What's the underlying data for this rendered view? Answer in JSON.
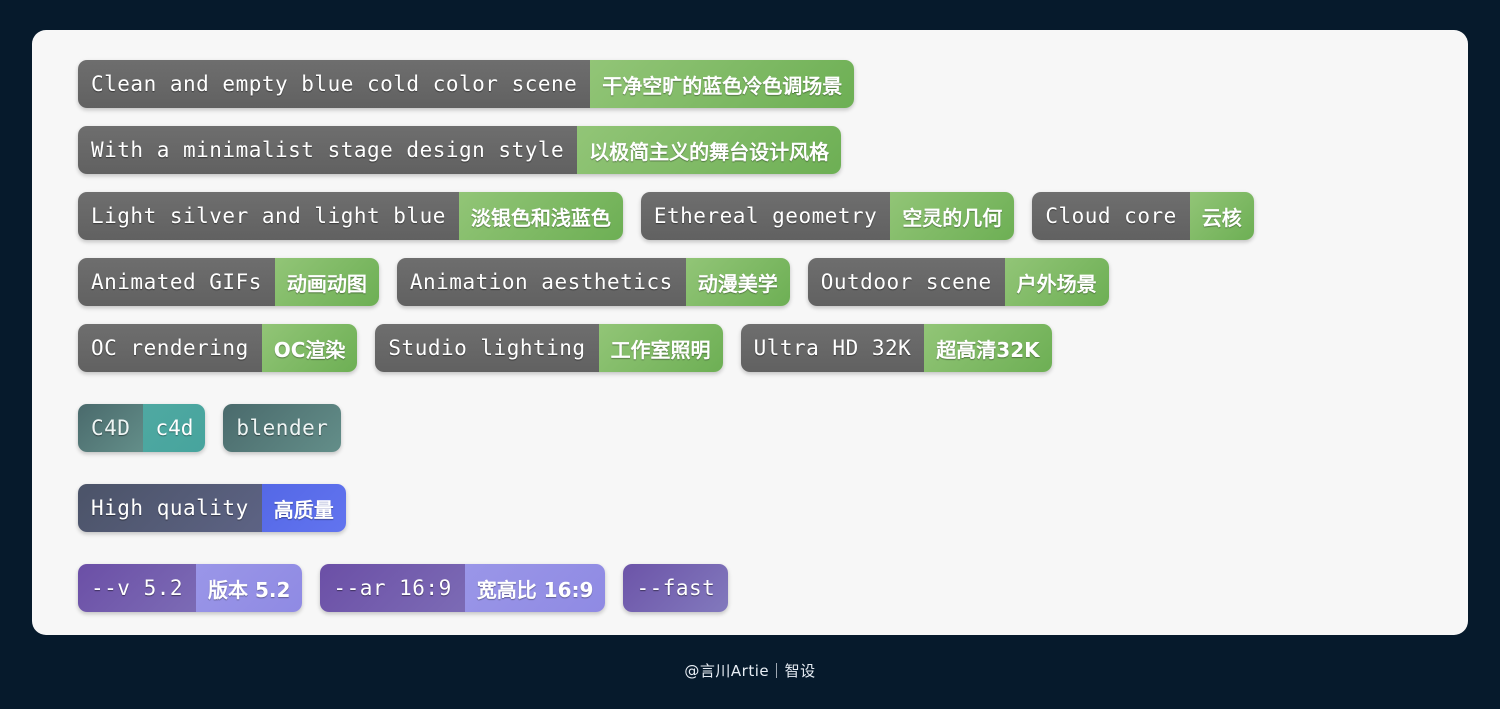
{
  "background_color": "#061a2c",
  "card_color": "#f7f7f7",
  "accent_colors": {
    "gray": "#666666",
    "green": "#6daf54",
    "teal": "#4fa9a2",
    "indigo": "#5468e6",
    "purple": "#8f8ae3"
  },
  "rows": [
    {
      "id": "row-1",
      "tags": [
        {
          "en": "Clean and empty blue cold color scene",
          "zh": "干净空旷的蓝色冷色调场景",
          "theme": "green"
        }
      ]
    },
    {
      "id": "row-2",
      "tags": [
        {
          "en": "With a minimalist stage design style",
          "zh": "以极简主义的舞台设计风格",
          "theme": "green"
        }
      ]
    },
    {
      "id": "row-3",
      "tags": [
        {
          "en": "Light silver and light blue",
          "zh": "淡银色和浅蓝色",
          "theme": "green"
        },
        {
          "en": "Ethereal geometry",
          "zh": "空灵的几何",
          "theme": "green"
        },
        {
          "en": "Cloud core",
          "zh": "云核",
          "theme": "green"
        }
      ]
    },
    {
      "id": "row-4",
      "tags": [
        {
          "en": "Animated GIFs",
          "zh": "动画动图",
          "theme": "green"
        },
        {
          "en": "Animation aesthetics",
          "zh": "动漫美学",
          "theme": "green"
        },
        {
          "en": "Outdoor scene",
          "zh": "户外场景",
          "theme": "green"
        }
      ]
    },
    {
      "id": "row-5",
      "tags": [
        {
          "en": "OC rendering",
          "zh": "OC渲染",
          "theme": "green"
        },
        {
          "en": "Studio lighting",
          "zh": "工作室照明",
          "theme": "green"
        },
        {
          "en": "Ultra HD 32K",
          "zh": "超高清32K",
          "theme": "green"
        }
      ]
    },
    {
      "id": "row-6",
      "tags": [
        {
          "en": "C4D",
          "zh": "c4d",
          "theme": "teal"
        },
        {
          "en": "blender",
          "zh": "",
          "theme": "teal"
        }
      ]
    },
    {
      "id": "row-7",
      "tags": [
        {
          "en": "High quality",
          "zh": "高质量",
          "theme": "indigo"
        }
      ]
    },
    {
      "id": "row-8",
      "tags": [
        {
          "en": "--v 5.2",
          "zh": "版本 5.2",
          "theme": "purple"
        },
        {
          "en": "--ar 16:9",
          "zh": "宽高比 16:9",
          "theme": "purple"
        },
        {
          "en": "--fast",
          "zh": "",
          "theme": "purple"
        }
      ]
    }
  ],
  "footer": {
    "credit": "@言川Artie｜智设"
  }
}
